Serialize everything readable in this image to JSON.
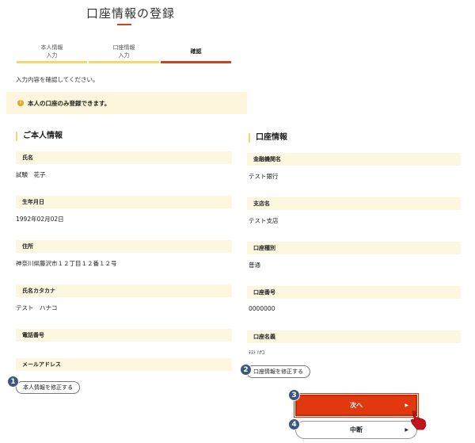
{
  "page_title": "口座情報の登録",
  "steps": [
    {
      "line1": "本人情報",
      "line2": "入力"
    },
    {
      "line1": "口座情報",
      "line2": "入力"
    },
    {
      "line1": "確認",
      "line2": ""
    }
  ],
  "lead_text": "入力内容を確認してください。",
  "notice_icon": "i",
  "notice_text": "本人の口座のみ登録できます。",
  "personal": {
    "section_title": "ご本人情報",
    "fields": [
      {
        "label": "氏名",
        "value": "試験　花子"
      },
      {
        "label": "生年月日",
        "value": "1992年02月02日"
      },
      {
        "label": "住所",
        "value": "神奈川県藤沢市１２丁目１２番１２号"
      },
      {
        "label": "氏名カタカナ",
        "value": "テスト　ハナコ"
      },
      {
        "label": "電話番号",
        "value": ""
      },
      {
        "label": "メールアドレス",
        "value": ""
      }
    ],
    "edit_button": "本人情報を修正する"
  },
  "account": {
    "section_title": "口座情報",
    "fields": [
      {
        "label": "金融機関名",
        "value": "テスト銀行"
      },
      {
        "label": "支店名",
        "value": "テスト支店"
      },
      {
        "label": "口座種別",
        "value": "普通"
      },
      {
        "label": "口座番号",
        "value": "0000000"
      },
      {
        "label": "口座名義",
        "value": "ﾃｽﾄ ﾊﾅｺ"
      }
    ],
    "edit_button": "口座情報を修正する"
  },
  "next_button": "次へ",
  "cancel_button": "中断",
  "button_arrow": "▶",
  "badges": [
    "1",
    "2",
    "3",
    "4"
  ],
  "colors": {
    "accent": "#e2380f",
    "step_active": "#d0421b",
    "step_inactive": "#f5d76e",
    "label_bg": "#fdf7e0",
    "badge": "#3a5780"
  }
}
